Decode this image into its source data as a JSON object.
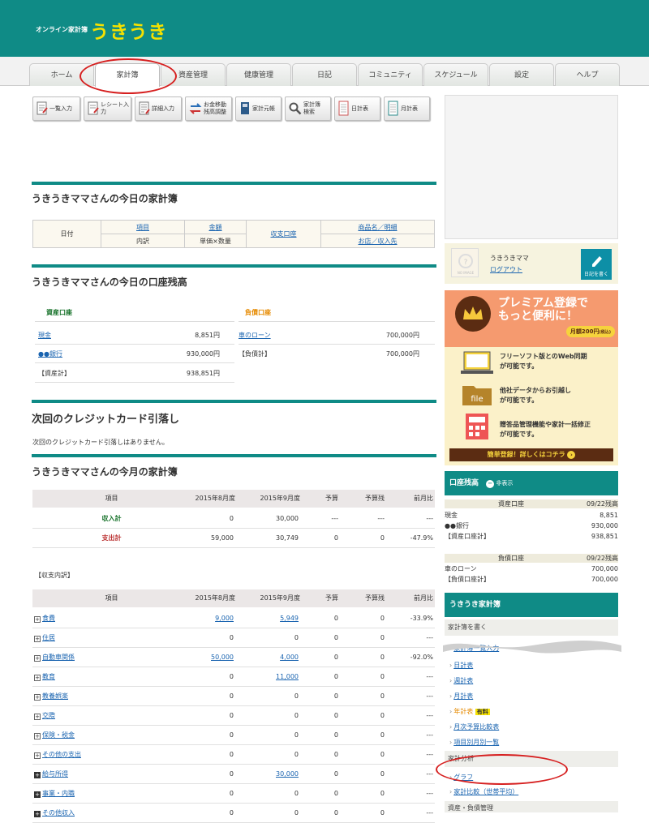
{
  "header": {
    "site_small": "オンライン家計簿",
    "site_name": "うきうき"
  },
  "tabs": [
    "ホーム",
    "家計簿",
    "資産管理",
    "健康管理",
    "日記",
    "コミュニティ",
    "スケジュール",
    "設定",
    "ヘルプ"
  ],
  "toolbar": [
    {
      "label": "一覧入力",
      "icon": "list-edit-icon"
    },
    {
      "label": "レシート入力",
      "icon": "receipt-icon"
    },
    {
      "label": "詳細入力",
      "icon": "detail-input-icon"
    },
    {
      "label": "お金移動\n残高調整",
      "icon": "transfer-icon"
    },
    {
      "label": "家計元帳",
      "icon": "ledger-icon"
    },
    {
      "label": "家計簿\n検索",
      "icon": "magnifier-icon"
    },
    {
      "label": "日計表",
      "icon": "daily-sheet-icon"
    },
    {
      "label": "月計表",
      "icon": "monthly-sheet-icon"
    }
  ],
  "today": {
    "title": "うきうきママさんの今日の家計簿",
    "headers": {
      "date": "日付",
      "item": "項目",
      "detail": "内訳",
      "amount": "金額",
      "unit_qty": "単価×数量",
      "account": "収支口座",
      "product": "商品名／明細",
      "shop": "お店／収入先"
    }
  },
  "balance": {
    "title": "うきうきママさんの今日の口座残高",
    "asset_header": "資産口座",
    "liability_header": "負債口座",
    "assets": [
      {
        "name": "現金",
        "value": "8,851円"
      },
      {
        "name": "●●銀行",
        "value": "930,000円"
      }
    ],
    "asset_total": {
      "name": "【資産計】",
      "value": "938,851円"
    },
    "liabilities": [
      {
        "name": "車のローン",
        "value": "700,000円"
      }
    ],
    "liability_total": {
      "name": "【負債計】",
      "value": "700,000円"
    }
  },
  "credit": {
    "title": "次回のクレジットカード引落し",
    "message": "次回のクレジットカード引落しはありません。"
  },
  "month": {
    "title": "うきうきママさんの今月の家計簿",
    "columns": [
      "項目",
      "2015年8月度",
      "2015年9月度",
      "予算",
      "予算残",
      "前月比"
    ],
    "summary": [
      {
        "label": "収入計",
        "aug": "0",
        "sep": "30,000",
        "budget": "---",
        "remain": "---",
        "ratio": "---"
      },
      {
        "label": "支出計",
        "aug": "59,000",
        "sep": "30,749",
        "budget": "0",
        "remain": "0",
        "ratio": "-47.9%"
      }
    ],
    "breakdown_label": "【収支内訳】",
    "rows": [
      {
        "label": "食費",
        "aug": "9,000",
        "sep": "5,949",
        "budget": "0",
        "remain": "0",
        "ratio": "-33.9%",
        "dark": false,
        "aug_link": true,
        "sep_link": true
      },
      {
        "label": "住居",
        "aug": "0",
        "sep": "0",
        "budget": "0",
        "remain": "0",
        "ratio": "---",
        "dark": false,
        "aug_link": false,
        "sep_link": false
      },
      {
        "label": "自動車関係",
        "aug": "50,000",
        "sep": "4,000",
        "budget": "0",
        "remain": "0",
        "ratio": "-92.0%",
        "dark": false,
        "aug_link": true,
        "sep_link": true
      },
      {
        "label": "教育",
        "aug": "0",
        "sep": "11,000",
        "budget": "0",
        "remain": "0",
        "ratio": "---",
        "dark": false,
        "aug_link": false,
        "sep_link": true
      },
      {
        "label": "教養娯楽",
        "aug": "0",
        "sep": "0",
        "budget": "0",
        "remain": "0",
        "ratio": "---",
        "dark": false,
        "aug_link": false,
        "sep_link": false
      },
      {
        "label": "交際",
        "aug": "0",
        "sep": "0",
        "budget": "0",
        "remain": "0",
        "ratio": "---",
        "dark": false,
        "aug_link": false,
        "sep_link": false
      },
      {
        "label": "保険・税金",
        "aug": "0",
        "sep": "0",
        "budget": "0",
        "remain": "0",
        "ratio": "---",
        "dark": false,
        "aug_link": false,
        "sep_link": false
      },
      {
        "label": "その他の支出",
        "aug": "0",
        "sep": "0",
        "budget": "0",
        "remain": "0",
        "ratio": "---",
        "dark": false,
        "aug_link": false,
        "sep_link": false
      },
      {
        "label": "給与所得",
        "aug": "0",
        "sep": "30,000",
        "budget": "0",
        "remain": "0",
        "ratio": "---",
        "dark": true,
        "aug_link": false,
        "sep_link": true
      },
      {
        "label": "事業・内職",
        "aug": "0",
        "sep": "0",
        "budget": "0",
        "remain": "0",
        "ratio": "---",
        "dark": true,
        "aug_link": false,
        "sep_link": false
      },
      {
        "label": "その他収入",
        "aug": "0",
        "sep": "0",
        "budget": "0",
        "remain": "0",
        "ratio": "---",
        "dark": true,
        "aug_link": false,
        "sep_link": false
      }
    ]
  },
  "user": {
    "name": "うきうきママ",
    "logout": "ログアウト",
    "no_image": "NO IMAGE",
    "diary_button": "日記を書く"
  },
  "premium": {
    "title_line1": "プレミアム登録で",
    "title_line2": "もっと便利に！",
    "price": "月額200円",
    "price_note": "(税込)",
    "feature1": "フリーソフト版とのWeb同期\nが可能です。",
    "feature2": "他社データからお引越し\nが可能です。",
    "feature3": "贈答品管理機能や家計一括修正\nが可能です。",
    "cta": "簡単登録！詳しくはコチラ",
    "file_label": "file"
  },
  "side_balance": {
    "title": "口座残高",
    "toggle": "非表示",
    "asset_header": "資産口座",
    "asset_date": "09/22残高",
    "assets": [
      {
        "name": "現金",
        "value": "8,851"
      },
      {
        "name": "●●銀行",
        "value": "930,000"
      },
      {
        "name": "【資産口座計】",
        "value": "938,851"
      }
    ],
    "liab_header": "負債口座",
    "liab_date": "09/22残高",
    "liabs": [
      {
        "name": "車のローン",
        "value": "700,000"
      },
      {
        "name": "【負債口座計】",
        "value": "700,000"
      }
    ]
  },
  "side_menu": {
    "title": "うきうき家計簿",
    "write_header": "家計簿を書く",
    "write_items": [
      "家計簿一覧入力",
      "日計表",
      "週計表",
      "月計表",
      "年計表",
      "月次予算比較表",
      "項目別月別一覧"
    ],
    "paid_badge": "有料",
    "analysis_header": "家計分析",
    "analysis_items": [
      "グラフ",
      "家計比較（世帯平均）"
    ],
    "asset_header": "資産・負債管理"
  }
}
